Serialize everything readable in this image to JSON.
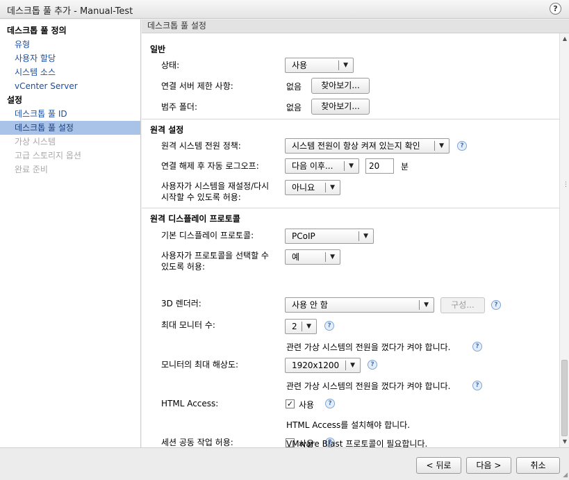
{
  "window": {
    "title": "데스크톱 풀 추가 - Manual-Test",
    "help_label": "?"
  },
  "sidebar": {
    "section1": "데스크톱 풀 정의",
    "items1": [
      "유형",
      "사용자 할당",
      "시스템 소스",
      "vCenter Server"
    ],
    "section2": "설정",
    "items2": [
      "데스크톱 풀 ID",
      "데스크톱 풀 설정",
      "가상 시스템",
      "고급 스토리지 옵션",
      "완료 준비"
    ]
  },
  "content": {
    "header": "데스크톱 풀 설정",
    "general": {
      "title": "일반",
      "state_label": "상태:",
      "state_value": "사용",
      "conn_label": "연결 서버 제한 사항:",
      "conn_value": "없음",
      "folder_label": "범주 폴더:",
      "folder_value": "없음",
      "browse_label": "찾아보기..."
    },
    "remote": {
      "title": "원격 설정",
      "power_label": "원격 시스템 전원 정책:",
      "power_value": "시스템 전원이 항상 켜져 있는지 확인",
      "logoff_label": "연결 해제 후 자동 로그오프:",
      "logoff_value": "다음 이후...",
      "logoff_minutes": "20",
      "minutes_unit": "분",
      "reset_label_1": "사용자가 시스템을 재설정/다시",
      "reset_label_2": "시작할 수 있도록 허용:",
      "reset_value": "아니요"
    },
    "protocol": {
      "title": "원격 디스플레이 프로토콜",
      "default_label": "기본 디스플레이 프로토콜:",
      "default_value": "PCoIP",
      "choose_label_1": "사용자가 프로토콜을 선택할 수",
      "choose_label_2": "있도록 허용:",
      "choose_value": "예",
      "renderer_label": "3D 렌더러:",
      "renderer_value": "사용 안 함",
      "config_label": "구성...",
      "monitors_label": "최대 모니터 수:",
      "monitors_value": "2",
      "power_note": "관련 가상 시스템의 전원을 껐다가 켜야 합니다.",
      "resolution_label": "모니터의 최대 해상도:",
      "resolution_value": "1920x1200",
      "html_label": "HTML Access:",
      "html_check": "✓",
      "use_label": "사용",
      "html_note": "HTML Access를 설치해야 합니다.",
      "collab_label": "세션 공동 작업 허용:",
      "blast_note": "VMware Blast 프로토콜이 필요합니다."
    }
  },
  "footer": {
    "back_label": "< 뒤로",
    "next_label": "다음 >",
    "cancel_label": "취소"
  }
}
